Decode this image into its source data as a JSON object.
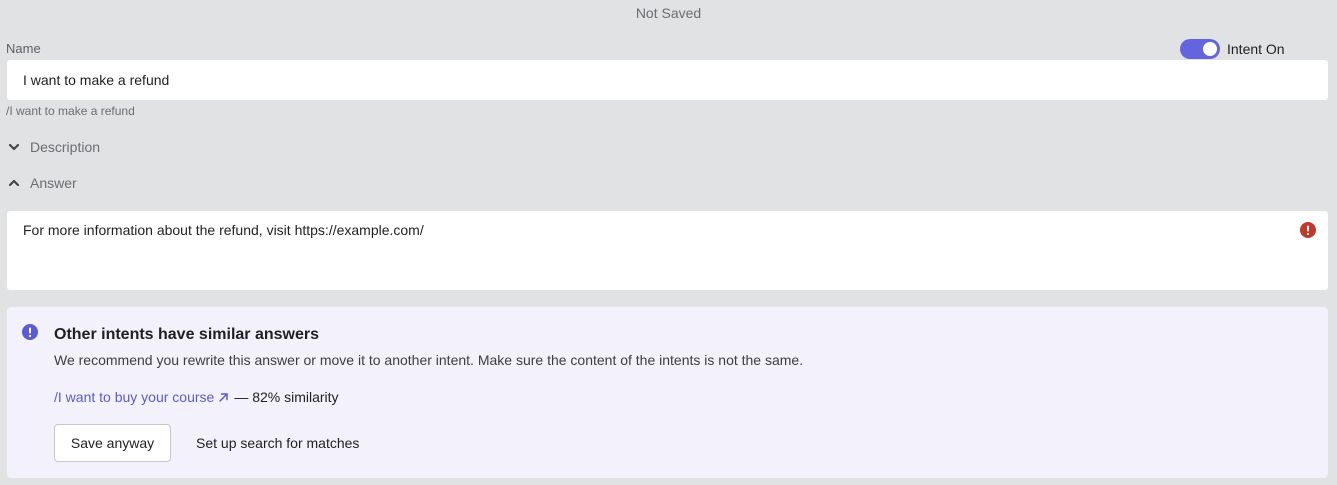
{
  "status": "Not Saved",
  "name_label": "Name",
  "toggle": {
    "label": "Intent On",
    "on": true,
    "color": "#6464df"
  },
  "name_input": {
    "value": "I want to make a refund"
  },
  "slug": "/I want to make a refund",
  "sections": {
    "description": "Description",
    "answer": "Answer"
  },
  "answer": {
    "text": "For more information about the refund, visit https://example.com/"
  },
  "alert": {
    "title": "Other intents have similar answers",
    "description": "We recommend you rewrite this answer or move it to another intent. Make sure the content of the intents is not the same.",
    "match_link": "/I want to buy your course",
    "match_similarity": "— 82% similarity",
    "save_button": "Save anyway",
    "setup_button": "Set up search for matches"
  },
  "colors": {
    "accent": "#5b5bd6",
    "error": "#c0392b",
    "alert_bg": "#f2f1fc"
  }
}
